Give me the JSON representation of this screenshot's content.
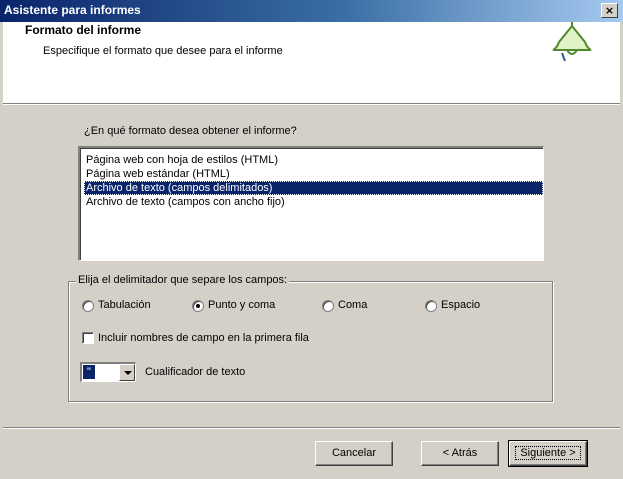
{
  "window": {
    "title": "Asistente para informes",
    "close_glyph": "×"
  },
  "header": {
    "title": "Formato del informe",
    "subtitle": "Especifique el formato que desee para el informe",
    "icon": "report-bell-icon"
  },
  "format": {
    "question": "¿En qué formato desea obtener el informe?",
    "options": [
      "Página web con hoja de estilos (HTML)",
      "Página web estándar (HTML)",
      "Archivo de texto (campos delimitados)",
      "Archivo de texto (campos con ancho fijo)"
    ],
    "selected_index": 2
  },
  "delimiter": {
    "legend": "Elija el delimitador que separe los campos:",
    "options": [
      "Tabulación",
      "Punto y coma",
      "Coma",
      "Espacio"
    ],
    "selected": "Punto y coma",
    "include_names_label": "Incluir nombres de campo en la primera fila",
    "include_names_checked": false,
    "qualifier_value": "\"",
    "qualifier_label": "Cualificador de texto"
  },
  "buttons": {
    "cancel": "Cancelar",
    "back": "< Atrás",
    "next": "Siguiente >"
  },
  "colors": {
    "selection": "#0a246a",
    "title_gradient_start": "#0a246a",
    "title_gradient_end": "#a6caf0"
  }
}
